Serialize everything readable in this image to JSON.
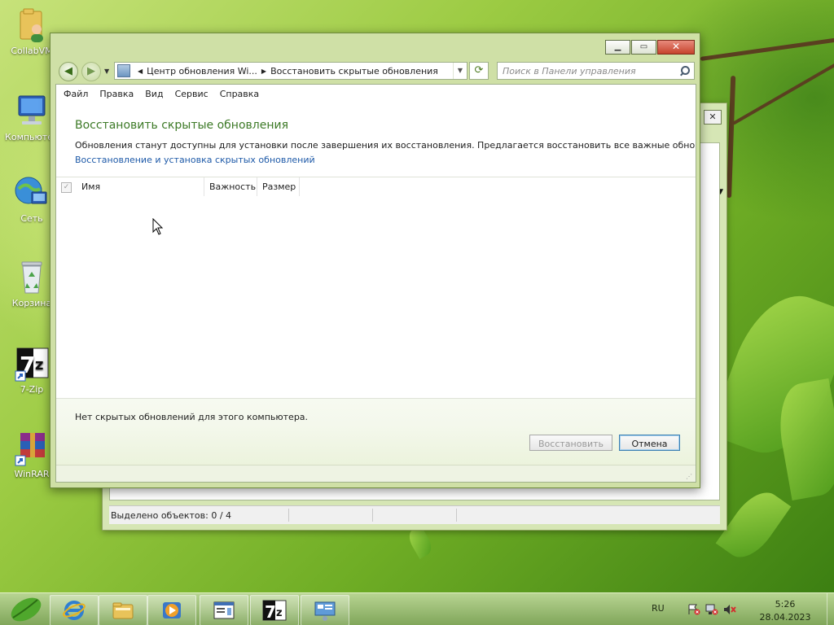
{
  "desktop": {
    "icons": [
      {
        "label": "CollabVM",
        "icon": "user-folder-icon"
      },
      {
        "label": "Компьютер",
        "icon": "computer-icon"
      },
      {
        "label": "Сеть",
        "icon": "network-icon"
      },
      {
        "label": "Корзина",
        "icon": "recycle-bin-icon"
      },
      {
        "label": "7-Zip",
        "icon": "7zip-icon"
      },
      {
        "label": "WinRAR",
        "icon": "winrar-icon"
      }
    ]
  },
  "background_window": {
    "status_text": "Выделено объектов: 0 / 4"
  },
  "window": {
    "address": {
      "segment1": "Центр обновления Wi...",
      "segment2": "Восстановить скрытые обновления"
    },
    "search_placeholder": "Поиск в Панели управления",
    "menu": [
      "Файл",
      "Правка",
      "Вид",
      "Сервис",
      "Справка"
    ],
    "heading": "Восстановить скрытые обновления",
    "description": "Обновления станут доступны для установки после завершения их восстановления. Предлагается восстановить все важные обновления.",
    "help_link": "Восстановление и установка скрытых обновлений",
    "columns": [
      "Имя",
      "Важность",
      "Размер"
    ],
    "rows": [],
    "empty_note": "Нет скрытых обновлений для этого компьютера.",
    "buttons": {
      "restore": "Восстановить",
      "cancel": "Отмена"
    },
    "restore_enabled": false
  },
  "taskbar": {
    "items": [
      {
        "name": "internet-explorer",
        "icon": "ie-icon"
      },
      {
        "name": "file-explorer",
        "icon": "folder-icon"
      },
      {
        "name": "media-player",
        "icon": "media-player-icon"
      },
      {
        "name": "app-window",
        "icon": "window-app-icon"
      },
      {
        "name": "7zip",
        "icon": "7zip-icon"
      },
      {
        "name": "control-panel",
        "icon": "control-panel-icon"
      }
    ],
    "tray": {
      "language": "RU",
      "time": "5:26",
      "date": "28.04.2023"
    }
  },
  "colors": {
    "heading": "#3d7a27",
    "link": "#1e5aa8",
    "window_frame": "#cfe0a6"
  }
}
